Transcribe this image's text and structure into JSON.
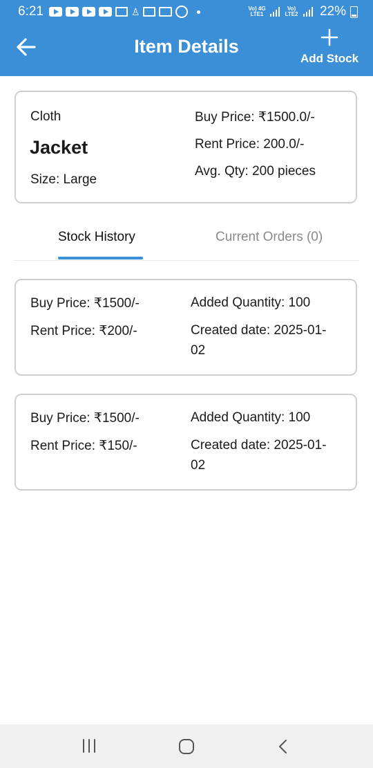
{
  "status_bar": {
    "time": "6:21",
    "network1": "Vo) 4G LTE1",
    "network2": "Vo) LTE2",
    "battery": "22%"
  },
  "app_bar": {
    "title": "Item Details",
    "add_stock_label": "Add Stock",
    "background_color": "#3b8fd6"
  },
  "item": {
    "category": "Cloth",
    "name": "Jacket",
    "size": "Size: Large",
    "buy_price": "Buy Price: ₹1500.0/-",
    "rent_price": "Rent Price: 200.0/-",
    "avg_qty": "Avg. Qty: 200 pieces"
  },
  "tabs": [
    {
      "label": "Stock History",
      "selected": true
    },
    {
      "label": "Current Orders (0)",
      "selected": false
    }
  ],
  "stock_history": [
    {
      "buy_price": "Buy Price: ₹1500/-",
      "rent_price": "Rent Price: ₹200/-",
      "added_quantity": "Added Quantity: 100",
      "created_date": "Created date: 2025-01-02"
    },
    {
      "buy_price": "Buy Price: ₹1500/-",
      "rent_price": "Rent Price: ₹150/-",
      "added_quantity": "Added Quantity: 100",
      "created_date": "Created date: 2025-01-02"
    }
  ],
  "nav_bar": {
    "icons": [
      "recents-icon",
      "home-icon",
      "back-icon"
    ]
  }
}
